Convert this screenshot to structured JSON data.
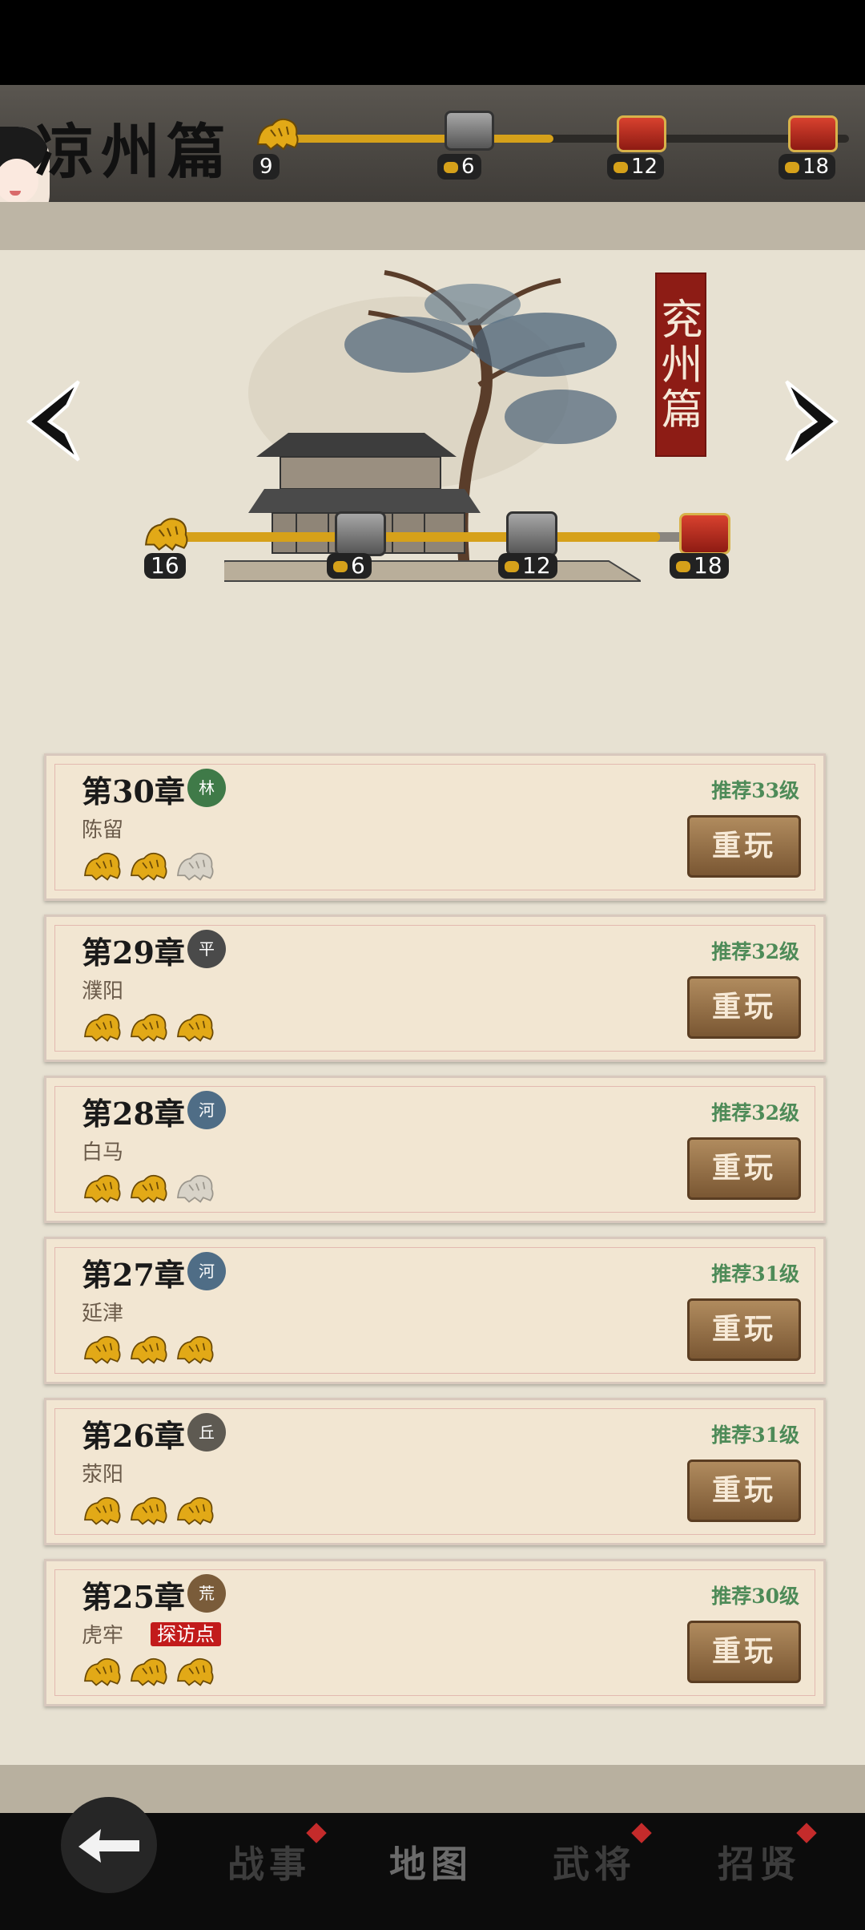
{
  "top_bar": {
    "title": "凉州篇",
    "stars_collected": "9",
    "milestones": [
      "6",
      "12",
      "18"
    ]
  },
  "region": {
    "seal_text": "兖州篇",
    "stars_collected": "16",
    "milestones": [
      "6",
      "12",
      "18"
    ],
    "progress_fraction": 0.89
  },
  "chapters": [
    {
      "title": "第30章",
      "badge": "林",
      "badge_color": "#3f7a48",
      "place": "陈留",
      "recommend": "推荐33级",
      "stars": 2,
      "button": "重玩"
    },
    {
      "title": "第29章",
      "badge": "平",
      "badge_color": "#4a4a4a",
      "place": "濮阳",
      "recommend": "推荐32级",
      "stars": 3,
      "button": "重玩"
    },
    {
      "title": "第28章",
      "badge": "河",
      "badge_color": "#4f6d86",
      "place": "白马",
      "recommend": "推荐32级",
      "stars": 2,
      "button": "重玩"
    },
    {
      "title": "第27章",
      "badge": "河",
      "badge_color": "#4f6d86",
      "place": "延津",
      "recommend": "推荐31级",
      "stars": 3,
      "button": "重玩"
    },
    {
      "title": "第26章",
      "badge": "丘",
      "badge_color": "#5e5a52",
      "place": "荥阳",
      "recommend": "推荐31级",
      "stars": 3,
      "button": "重玩"
    },
    {
      "title": "第25章",
      "badge": "荒",
      "badge_color": "#7a5c3a",
      "place": "虎牢",
      "tag": "探访点",
      "recommend": "推荐30级",
      "stars": 3,
      "button": "重玩"
    }
  ],
  "nav": {
    "items": [
      "战事",
      "地图",
      "武将",
      "招贤"
    ],
    "active": "地图"
  },
  "icons": {
    "back": "back-arrow-icon",
    "prev": "chevron-left-icon",
    "next": "chevron-right-icon",
    "star": "golden-tiger-icon",
    "chest_silver": "silver-chest-icon",
    "chest_red": "red-chest-icon"
  }
}
